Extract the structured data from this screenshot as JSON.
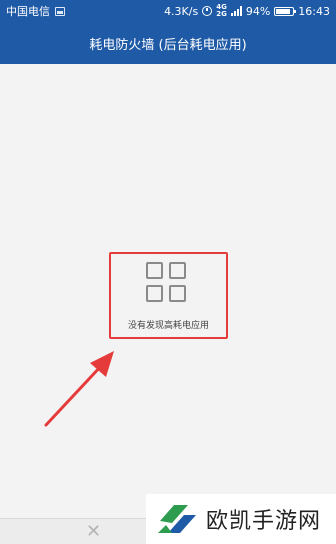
{
  "status_bar": {
    "carrier": "中国电信",
    "speed": "4.3K/s",
    "network_top": "4G",
    "network_bottom": "2G",
    "battery": "94%",
    "battery_level": 0.94,
    "time": "16:43"
  },
  "header": {
    "title": "耗电防火墙 (后台耗电应用)"
  },
  "empty_state": {
    "message": "没有发现高耗电应用"
  },
  "annotation": {
    "color": "#e53b3b"
  },
  "watermark": {
    "text": "欧凯手游网"
  }
}
